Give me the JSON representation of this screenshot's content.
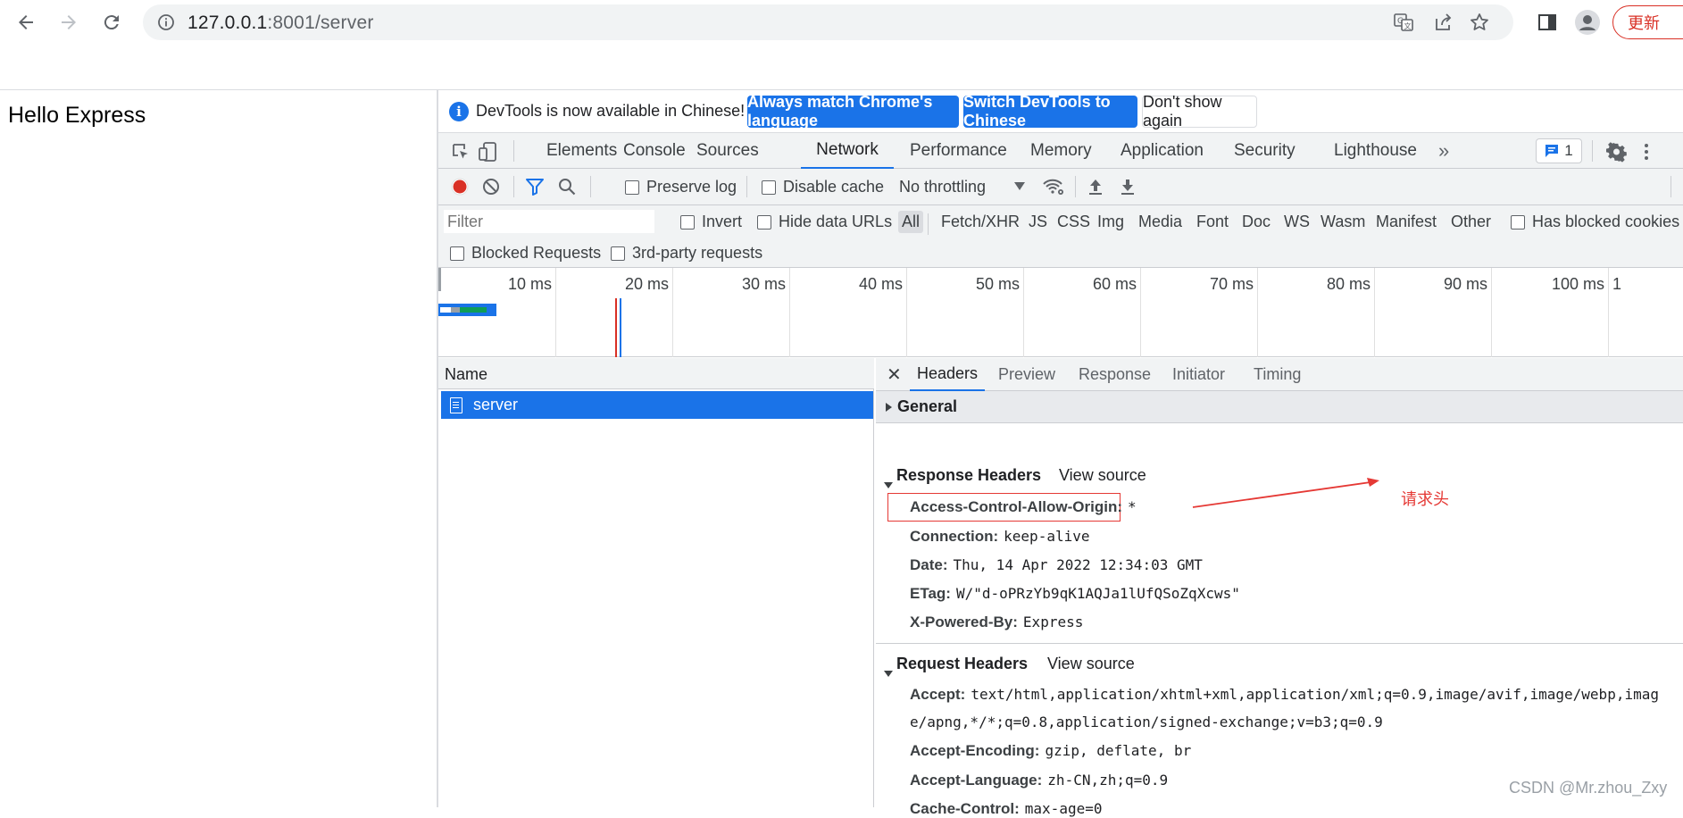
{
  "browser": {
    "url_host": "127.0.0.1",
    "url_path": ":8001/server",
    "update_label": "更新"
  },
  "page": {
    "body_text": "Hello Express"
  },
  "devtools": {
    "infobar": {
      "message": "DevTools is now available in Chinese!",
      "btn_match": "Always match Chrome's language",
      "btn_switch": "Switch DevTools to Chinese",
      "btn_dismiss": "Don't show again"
    },
    "tabs": [
      "Elements",
      "Console",
      "Sources",
      "Network",
      "Performance",
      "Memory",
      "Application",
      "Security",
      "Lighthouse"
    ],
    "active_tab": "Network",
    "issues_count": "1",
    "toolbar": {
      "preserve_log": "Preserve log",
      "disable_cache": "Disable cache",
      "throttling": "No throttling"
    },
    "filter": {
      "placeholder": "Filter",
      "invert": "Invert",
      "hide_data_urls": "Hide data URLs",
      "types": [
        "All",
        "Fetch/XHR",
        "JS",
        "CSS",
        "Img",
        "Media",
        "Font",
        "Doc",
        "WS",
        "Wasm",
        "Manifest",
        "Other"
      ],
      "has_blocked_cookies": "Has blocked cookies",
      "blocked_requests": "Blocked Requests",
      "third_party": "3rd-party requests"
    },
    "timeline_ticks": [
      "10 ms",
      "20 ms",
      "30 ms",
      "40 ms",
      "50 ms",
      "60 ms",
      "70 ms",
      "80 ms",
      "90 ms",
      "100 ms",
      "1"
    ],
    "request_list": {
      "header": "Name",
      "requests": [
        {
          "name": "server",
          "selected": true
        }
      ]
    },
    "detail": {
      "tabs": [
        "Headers",
        "Preview",
        "Response",
        "Initiator",
        "Timing"
      ],
      "active_tab": "Headers",
      "general_label": "General",
      "response_headers_title": "Response Headers",
      "request_headers_title": "Request Headers",
      "view_source": "View source",
      "response_headers": [
        {
          "name": "Access-Control-Allow-Origin:",
          "value": "*"
        },
        {
          "name": "Connection:",
          "value": "keep-alive"
        },
        {
          "name": "Date:",
          "value": "Thu, 14 Apr 2022 12:34:03 GMT"
        },
        {
          "name": "ETag:",
          "value": "W/\"d-oPRzYb9qK1AQJa1lUfQSoZqXcws\""
        },
        {
          "name": "X-Powered-By:",
          "value": "Express"
        }
      ],
      "request_headers": [
        {
          "name": "Accept:",
          "value": "text/html,application/xhtml+xml,application/xml;q=0.9,image/avif,image/webp,imag",
          "value_cont": "e/apng,*/*;q=0.8,application/signed-exchange;v=b3;q=0.9"
        },
        {
          "name": "Accept-Encoding:",
          "value": "gzip, deflate, br"
        },
        {
          "name": "Accept-Language:",
          "value": "zh-CN,zh;q=0.9"
        },
        {
          "name": "Cache-Control:",
          "value": "max-age=0"
        }
      ]
    }
  },
  "annotation": {
    "label": "请求头",
    "color": "#e53935"
  },
  "watermark": "CSDN @Mr.zhou_Zxy"
}
